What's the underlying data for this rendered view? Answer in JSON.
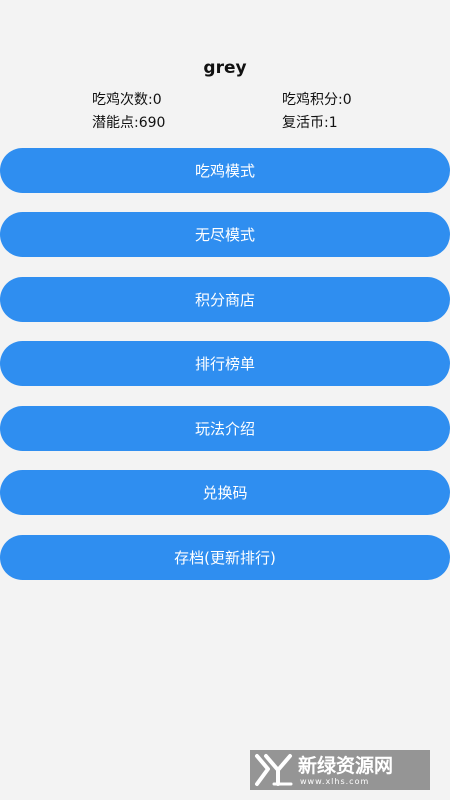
{
  "profile": {
    "username": "grey",
    "stats": {
      "chicken_wins": "吃鸡次数:0",
      "chicken_points": "吃鸡积分:0",
      "potential_points": "潜能点:690",
      "revive_coins": "复活币:1"
    }
  },
  "menu": {
    "buttons": [
      {
        "label": "吃鸡模式"
      },
      {
        "label": "无尽模式"
      },
      {
        "label": "积分商店"
      },
      {
        "label": "排行榜单"
      },
      {
        "label": "玩法介绍"
      },
      {
        "label": "兑换码"
      },
      {
        "label": "存档(更新排行)"
      }
    ]
  },
  "watermark": {
    "brand": "新绿资源网",
    "site": "www.xlhs.com",
    "logo_icon": "xl-logo-icon"
  },
  "colors": {
    "background": "#f3f3f3",
    "button": "#2f8ef0",
    "button_text": "#ffffff"
  }
}
